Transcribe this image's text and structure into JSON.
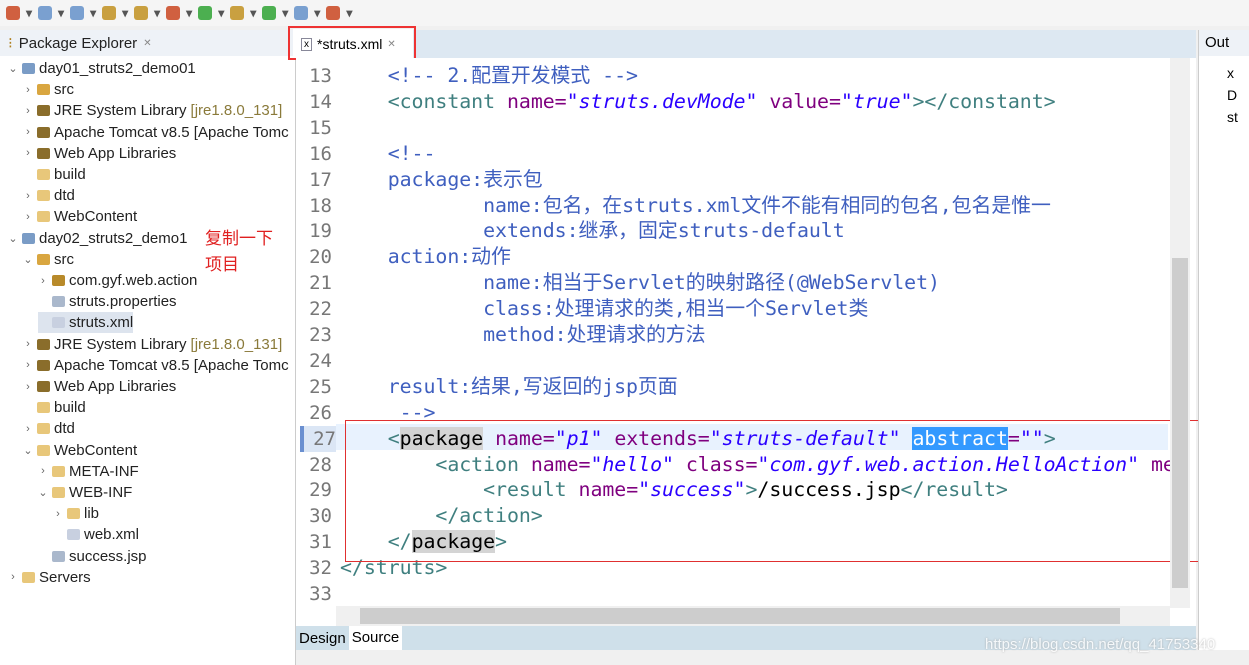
{
  "toolbar": {
    "icons": [
      "new",
      "save",
      "save-all",
      "print",
      "debug",
      "run",
      "external-tools",
      "open-type",
      "search",
      "back",
      "forward"
    ]
  },
  "package_explorer": {
    "title": "Package Explorer",
    "tree": [
      {
        "label": "day01_struts2_demo01",
        "depth": 0,
        "twisty": "v",
        "icon": "project"
      },
      {
        "label": "src",
        "depth": 1,
        "twisty": ">",
        "icon": "src"
      },
      {
        "label": "JRE System Library",
        "decoration": "[jre1.8.0_131]",
        "depth": 1,
        "twisty": ">",
        "icon": "library"
      },
      {
        "label": "Apache Tomcat v8.5 [Apache Tomc",
        "depth": 1,
        "twisty": ">",
        "icon": "library"
      },
      {
        "label": "Web App Libraries",
        "depth": 1,
        "twisty": ">",
        "icon": "library"
      },
      {
        "label": "build",
        "depth": 1,
        "twisty": "",
        "icon": "folder"
      },
      {
        "label": "dtd",
        "depth": 1,
        "twisty": ">",
        "icon": "folder"
      },
      {
        "label": "WebContent",
        "depth": 1,
        "twisty": ">",
        "icon": "folder"
      },
      {
        "label": "day02_struts2_demo1",
        "depth": 0,
        "twisty": "v",
        "icon": "project"
      },
      {
        "label": "src",
        "depth": 1,
        "twisty": "v",
        "icon": "src"
      },
      {
        "label": "com.gyf.web.action",
        "depth": 2,
        "twisty": ">",
        "icon": "package"
      },
      {
        "label": "struts.properties",
        "depth": 2,
        "twisty": "",
        "icon": "file"
      },
      {
        "label": "struts.xml",
        "depth": 2,
        "twisty": "",
        "icon": "xml",
        "selected": true
      },
      {
        "label": "JRE System Library",
        "decoration": "[jre1.8.0_131]",
        "depth": 1,
        "twisty": ">",
        "icon": "library"
      },
      {
        "label": "Apache Tomcat v8.5 [Apache Tomc",
        "depth": 1,
        "twisty": ">",
        "icon": "library"
      },
      {
        "label": "Web App Libraries",
        "depth": 1,
        "twisty": ">",
        "icon": "library"
      },
      {
        "label": "build",
        "depth": 1,
        "twisty": "",
        "icon": "folder"
      },
      {
        "label": "dtd",
        "depth": 1,
        "twisty": ">",
        "icon": "folder"
      },
      {
        "label": "WebContent",
        "depth": 1,
        "twisty": "v",
        "icon": "folder"
      },
      {
        "label": "META-INF",
        "depth": 2,
        "twisty": ">",
        "icon": "folder"
      },
      {
        "label": "WEB-INF",
        "depth": 2,
        "twisty": "v",
        "icon": "folder"
      },
      {
        "label": "lib",
        "depth": 3,
        "twisty": ">",
        "icon": "folder"
      },
      {
        "label": "web.xml",
        "depth": 3,
        "twisty": "",
        "icon": "xml"
      },
      {
        "label": "success.jsp",
        "depth": 2,
        "twisty": "",
        "icon": "file"
      },
      {
        "label": "Servers",
        "depth": 0,
        "twisty": ">",
        "icon": "folder"
      }
    ]
  },
  "annotation": "复制一下项目",
  "editor": {
    "tab": "*struts.xml",
    "current_line": 27,
    "lines": [
      {
        "n": "13",
        "tokens": [
          [
            "x",
            "    "
          ],
          [
            "c",
            "<!-- 2.配置开发模式 -->"
          ]
        ]
      },
      {
        "n": "14",
        "tokens": [
          [
            "x",
            "    "
          ],
          [
            "t",
            "<constant "
          ],
          [
            "a",
            "name="
          ],
          [
            "v",
            "\"struts.devMode\""
          ],
          [
            "a",
            " value="
          ],
          [
            "v",
            "\"true\""
          ],
          [
            "t",
            "></constant>"
          ]
        ]
      },
      {
        "n": "15",
        "tokens": []
      },
      {
        "n": "16",
        "tokens": [
          [
            "x",
            "    "
          ],
          [
            "c",
            "<!--"
          ]
        ]
      },
      {
        "n": "17",
        "tokens": [
          [
            "c",
            "    package:表示包"
          ]
        ]
      },
      {
        "n": "18",
        "tokens": [
          [
            "c",
            "            name:包名，在struts.xml文件不能有相同的包名,包名是惟一"
          ]
        ]
      },
      {
        "n": "19",
        "tokens": [
          [
            "c",
            "            extends:继承，固定struts-default"
          ]
        ]
      },
      {
        "n": "20",
        "tokens": [
          [
            "c",
            "    action:动作"
          ]
        ]
      },
      {
        "n": "21",
        "tokens": [
          [
            "c",
            "            name:相当于Servlet的映射路径(@WebServlet)"
          ]
        ]
      },
      {
        "n": "22",
        "tokens": [
          [
            "c",
            "            class:处理请求的类,相当一个Servlet类"
          ]
        ]
      },
      {
        "n": "23",
        "tokens": [
          [
            "c",
            "            method:处理请求的方法"
          ]
        ]
      },
      {
        "n": "24",
        "tokens": []
      },
      {
        "n": "25",
        "tokens": [
          [
            "c",
            "    result:结果,写返回的jsp页面"
          ]
        ]
      },
      {
        "n": "26",
        "tokens": [
          [
            "c",
            "     -->"
          ]
        ]
      },
      {
        "n": "27",
        "tokens": [
          [
            "x",
            "    "
          ],
          [
            "t",
            "<"
          ],
          [
            "h",
            "package"
          ],
          [
            "t",
            " "
          ],
          [
            "a",
            "name="
          ],
          [
            "v",
            "\"p1\""
          ],
          [
            "a",
            " extends="
          ],
          [
            "v",
            "\"struts-default\""
          ],
          [
            "x",
            " "
          ],
          [
            "s",
            "abstract"
          ],
          [
            "a",
            "="
          ],
          [
            "v",
            "\"\""
          ],
          [
            "t",
            ">"
          ]
        ]
      },
      {
        "n": "28",
        "tokens": [
          [
            "x",
            "        "
          ],
          [
            "t",
            "<action "
          ],
          [
            "a",
            "name="
          ],
          [
            "v",
            "\"hello\""
          ],
          [
            "a",
            " class="
          ],
          [
            "v",
            "\"com.gyf.web.action.HelloAction\""
          ],
          [
            "a",
            " me"
          ]
        ]
      },
      {
        "n": "29",
        "tokens": [
          [
            "x",
            "            "
          ],
          [
            "t",
            "<result "
          ],
          [
            "a",
            "name="
          ],
          [
            "v",
            "\"success\""
          ],
          [
            "t",
            ">"
          ],
          [
            "x",
            "/success.jsp"
          ],
          [
            "t",
            "</result>"
          ]
        ]
      },
      {
        "n": "30",
        "tokens": [
          [
            "x",
            "        "
          ],
          [
            "t",
            "</action>"
          ]
        ]
      },
      {
        "n": "31",
        "tokens": [
          [
            "x",
            "    "
          ],
          [
            "t",
            "</"
          ],
          [
            "h",
            "package"
          ],
          [
            "t",
            ">"
          ]
        ]
      },
      {
        "n": "32",
        "tokens": [
          [
            "t",
            "</struts>"
          ]
        ]
      },
      {
        "n": "33",
        "tokens": []
      }
    ],
    "bottom_tabs": [
      "Design",
      "Source"
    ],
    "active_bottom_tab": "Source"
  },
  "outline": {
    "title": "Out",
    "items": [
      "x",
      "D",
      "st"
    ]
  },
  "watermark": "https://blog.csdn.net/qq_41753340",
  "colors": {
    "comment": "#3f5fbf",
    "tag": "#3f7f7f",
    "attr": "#7f007f",
    "value": "#2a00ff",
    "selection": "#3399ff",
    "annotation": "#e02020"
  }
}
